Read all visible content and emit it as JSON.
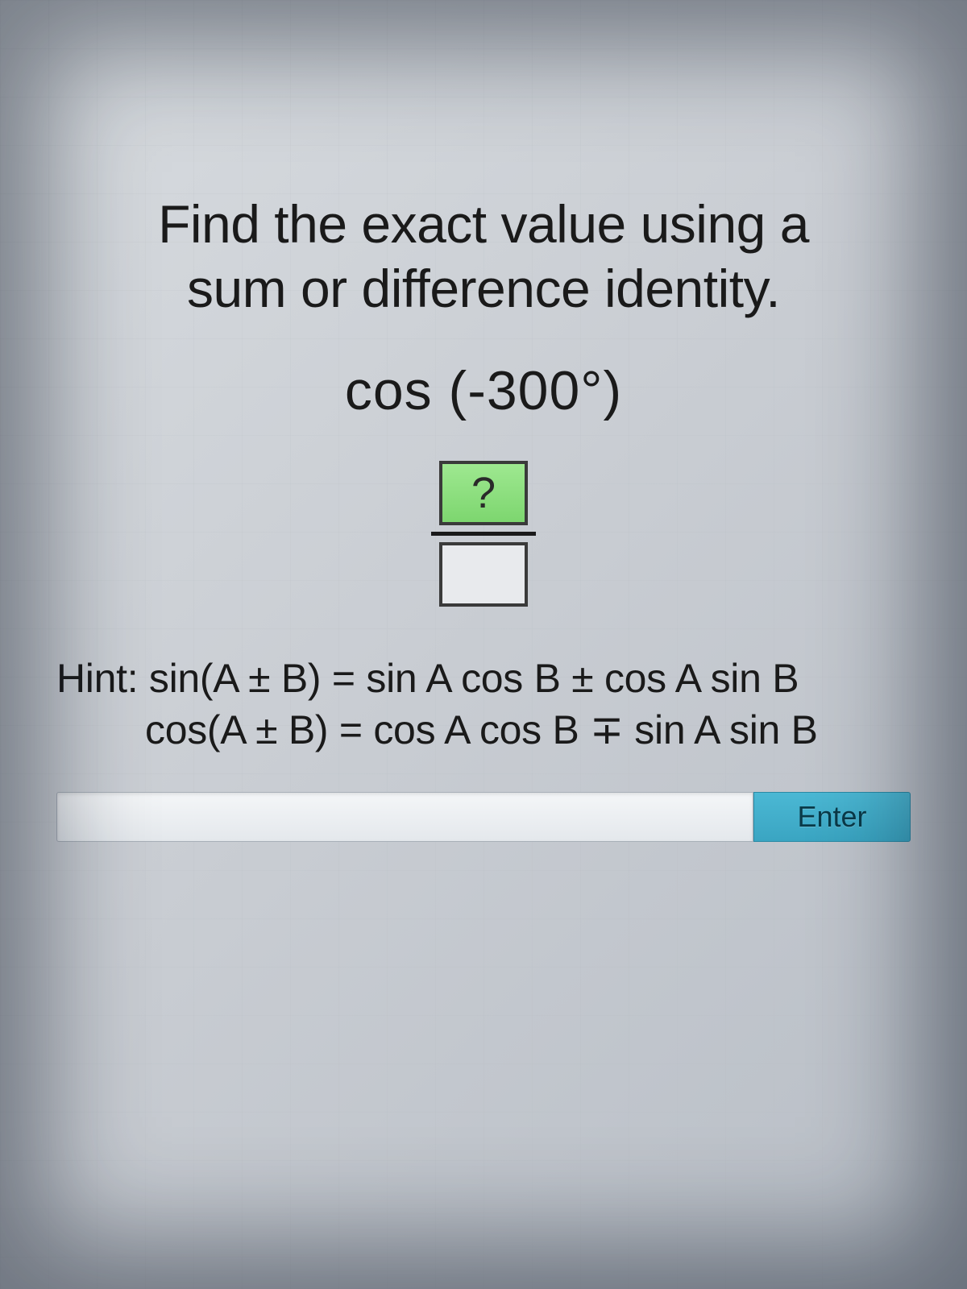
{
  "prompt": {
    "line1": "Find the exact value using a",
    "line2": "sum or difference identity."
  },
  "expression": "cos (-300°)",
  "fraction": {
    "numerator": "?",
    "denominator": ""
  },
  "hint": {
    "line1": "Hint: sin(A ± B) = sin A cos B ± cos A sin B",
    "line2": "cos(A ± B) = cos A cos B ∓ sin A sin B"
  },
  "answer_input": {
    "value": "",
    "placeholder": ""
  },
  "enter_button_label": "Enter"
}
